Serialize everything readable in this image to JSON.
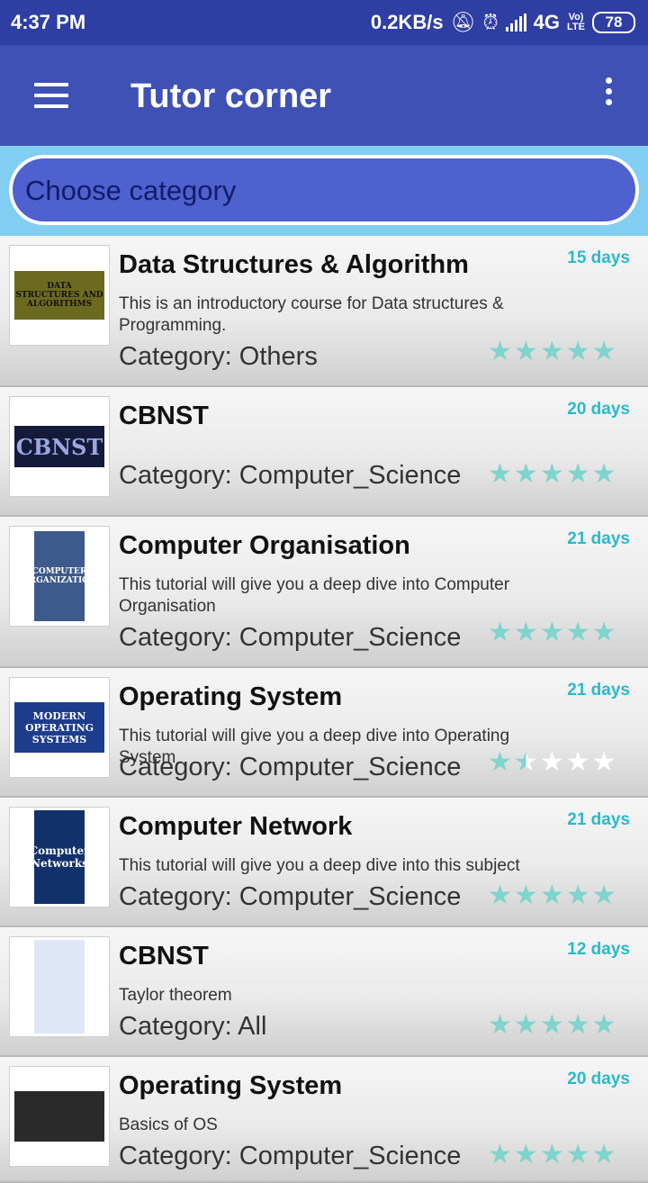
{
  "status_bar": {
    "time": "4:37 PM",
    "net_speed": "0.2KB/s",
    "network": "4G",
    "volte_top": "Vo)",
    "volte_bottom": "LTE",
    "battery": "78",
    "icons": [
      "mute-bell-icon",
      "alarm-icon",
      "signal-icon"
    ]
  },
  "app_bar": {
    "title": "Tutor corner",
    "menu_icon": "hamburger-icon",
    "overflow_icon": "more-vert-icon"
  },
  "category_selector": {
    "label": "Choose category"
  },
  "colors": {
    "status_bar": "#2e3ea3",
    "app_bar": "#3f51b5",
    "category_background": "#82cdf2",
    "category_pill": "#4f60cf",
    "days_text": "#2bb9c9",
    "star": "#7fd4cc"
  },
  "courses": [
    {
      "title": "Data Structures & Algorithm",
      "days": "15 days",
      "description": "This is an introductory course for Data structures & Programming.",
      "category": "Category: Others",
      "rating": 5,
      "thumb_text": "DATA STRUCTURES AND ALGORITHMS"
    },
    {
      "title": "CBNST",
      "days": "20 days",
      "description": "",
      "category": "Category: Computer_Science",
      "rating": 5,
      "thumb_text": "CBNST"
    },
    {
      "title": "Computer Organisation",
      "days": "21 days",
      "description": "This tutorial will give you a deep dive into Computer Organisation",
      "category": "Category: Computer_Science",
      "rating": 5,
      "thumb_text": "COMPUTER ORGANIZATION"
    },
    {
      "title": "Operating System",
      "days": "21 days",
      "description": "This tutorial will give you a deep dive into Operating System",
      "category": "Category: Computer_Science",
      "rating": 1.5,
      "thumb_text": "MODERN OPERATING SYSTEMS"
    },
    {
      "title": "Computer Network",
      "days": "21 days",
      "description": "This tutorial will give you a deep dive into this subject",
      "category": "Category: Computer_Science",
      "rating": 5,
      "thumb_text": "Computer Networks"
    },
    {
      "title": "CBNST",
      "days": "12 days",
      "description": "Taylor theorem",
      "category": "Category: All",
      "rating": 5,
      "thumb_text": ""
    },
    {
      "title": "Operating System",
      "days": "20 days",
      "description": "Basics of OS",
      "category": "Category: Computer_Science",
      "rating": 5,
      "thumb_text": ""
    }
  ]
}
